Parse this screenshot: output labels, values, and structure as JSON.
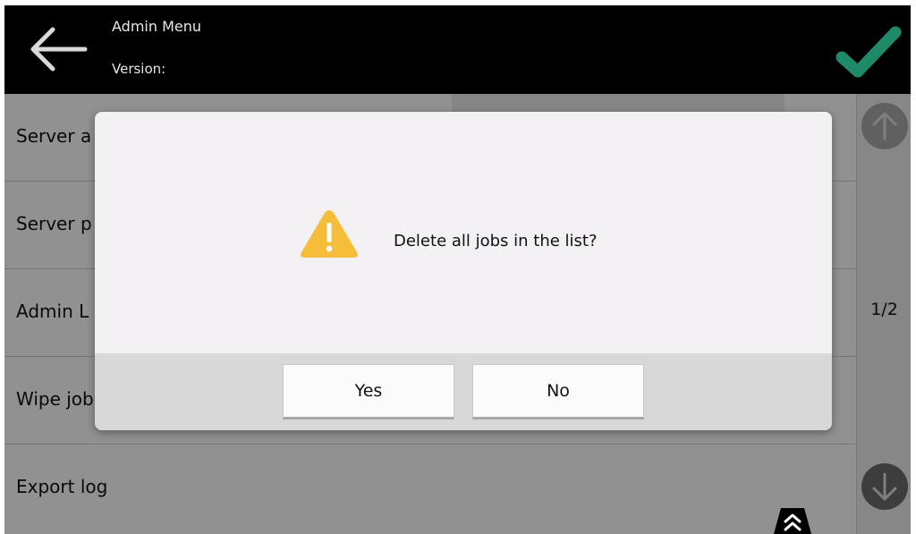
{
  "header": {
    "title": "Admin Menu",
    "version_label": "Version:",
    "back_icon": "back-arrow-icon",
    "ok_icon": "checkmark-icon"
  },
  "list": {
    "items": [
      {
        "label": "Server a"
      },
      {
        "label": "Server p"
      },
      {
        "label": "Admin L"
      },
      {
        "label": "Wipe job"
      },
      {
        "label": "Export log"
      }
    ]
  },
  "scroller": {
    "page": "1/2",
    "up_icon": "arrow-up-icon",
    "down_icon": "arrow-down-icon"
  },
  "expand_tab_icon": "double-chevron-up-icon",
  "dialog": {
    "message": "Delete all jobs in the list?",
    "icon": "warning-icon",
    "yes_label": "Yes",
    "no_label": "No"
  },
  "colors": {
    "header_bg": "#000000",
    "checkmark": "#1f8a6a",
    "warning": "#f5bd3a",
    "overlay": "rgba(0,0,0,0.43)"
  }
}
